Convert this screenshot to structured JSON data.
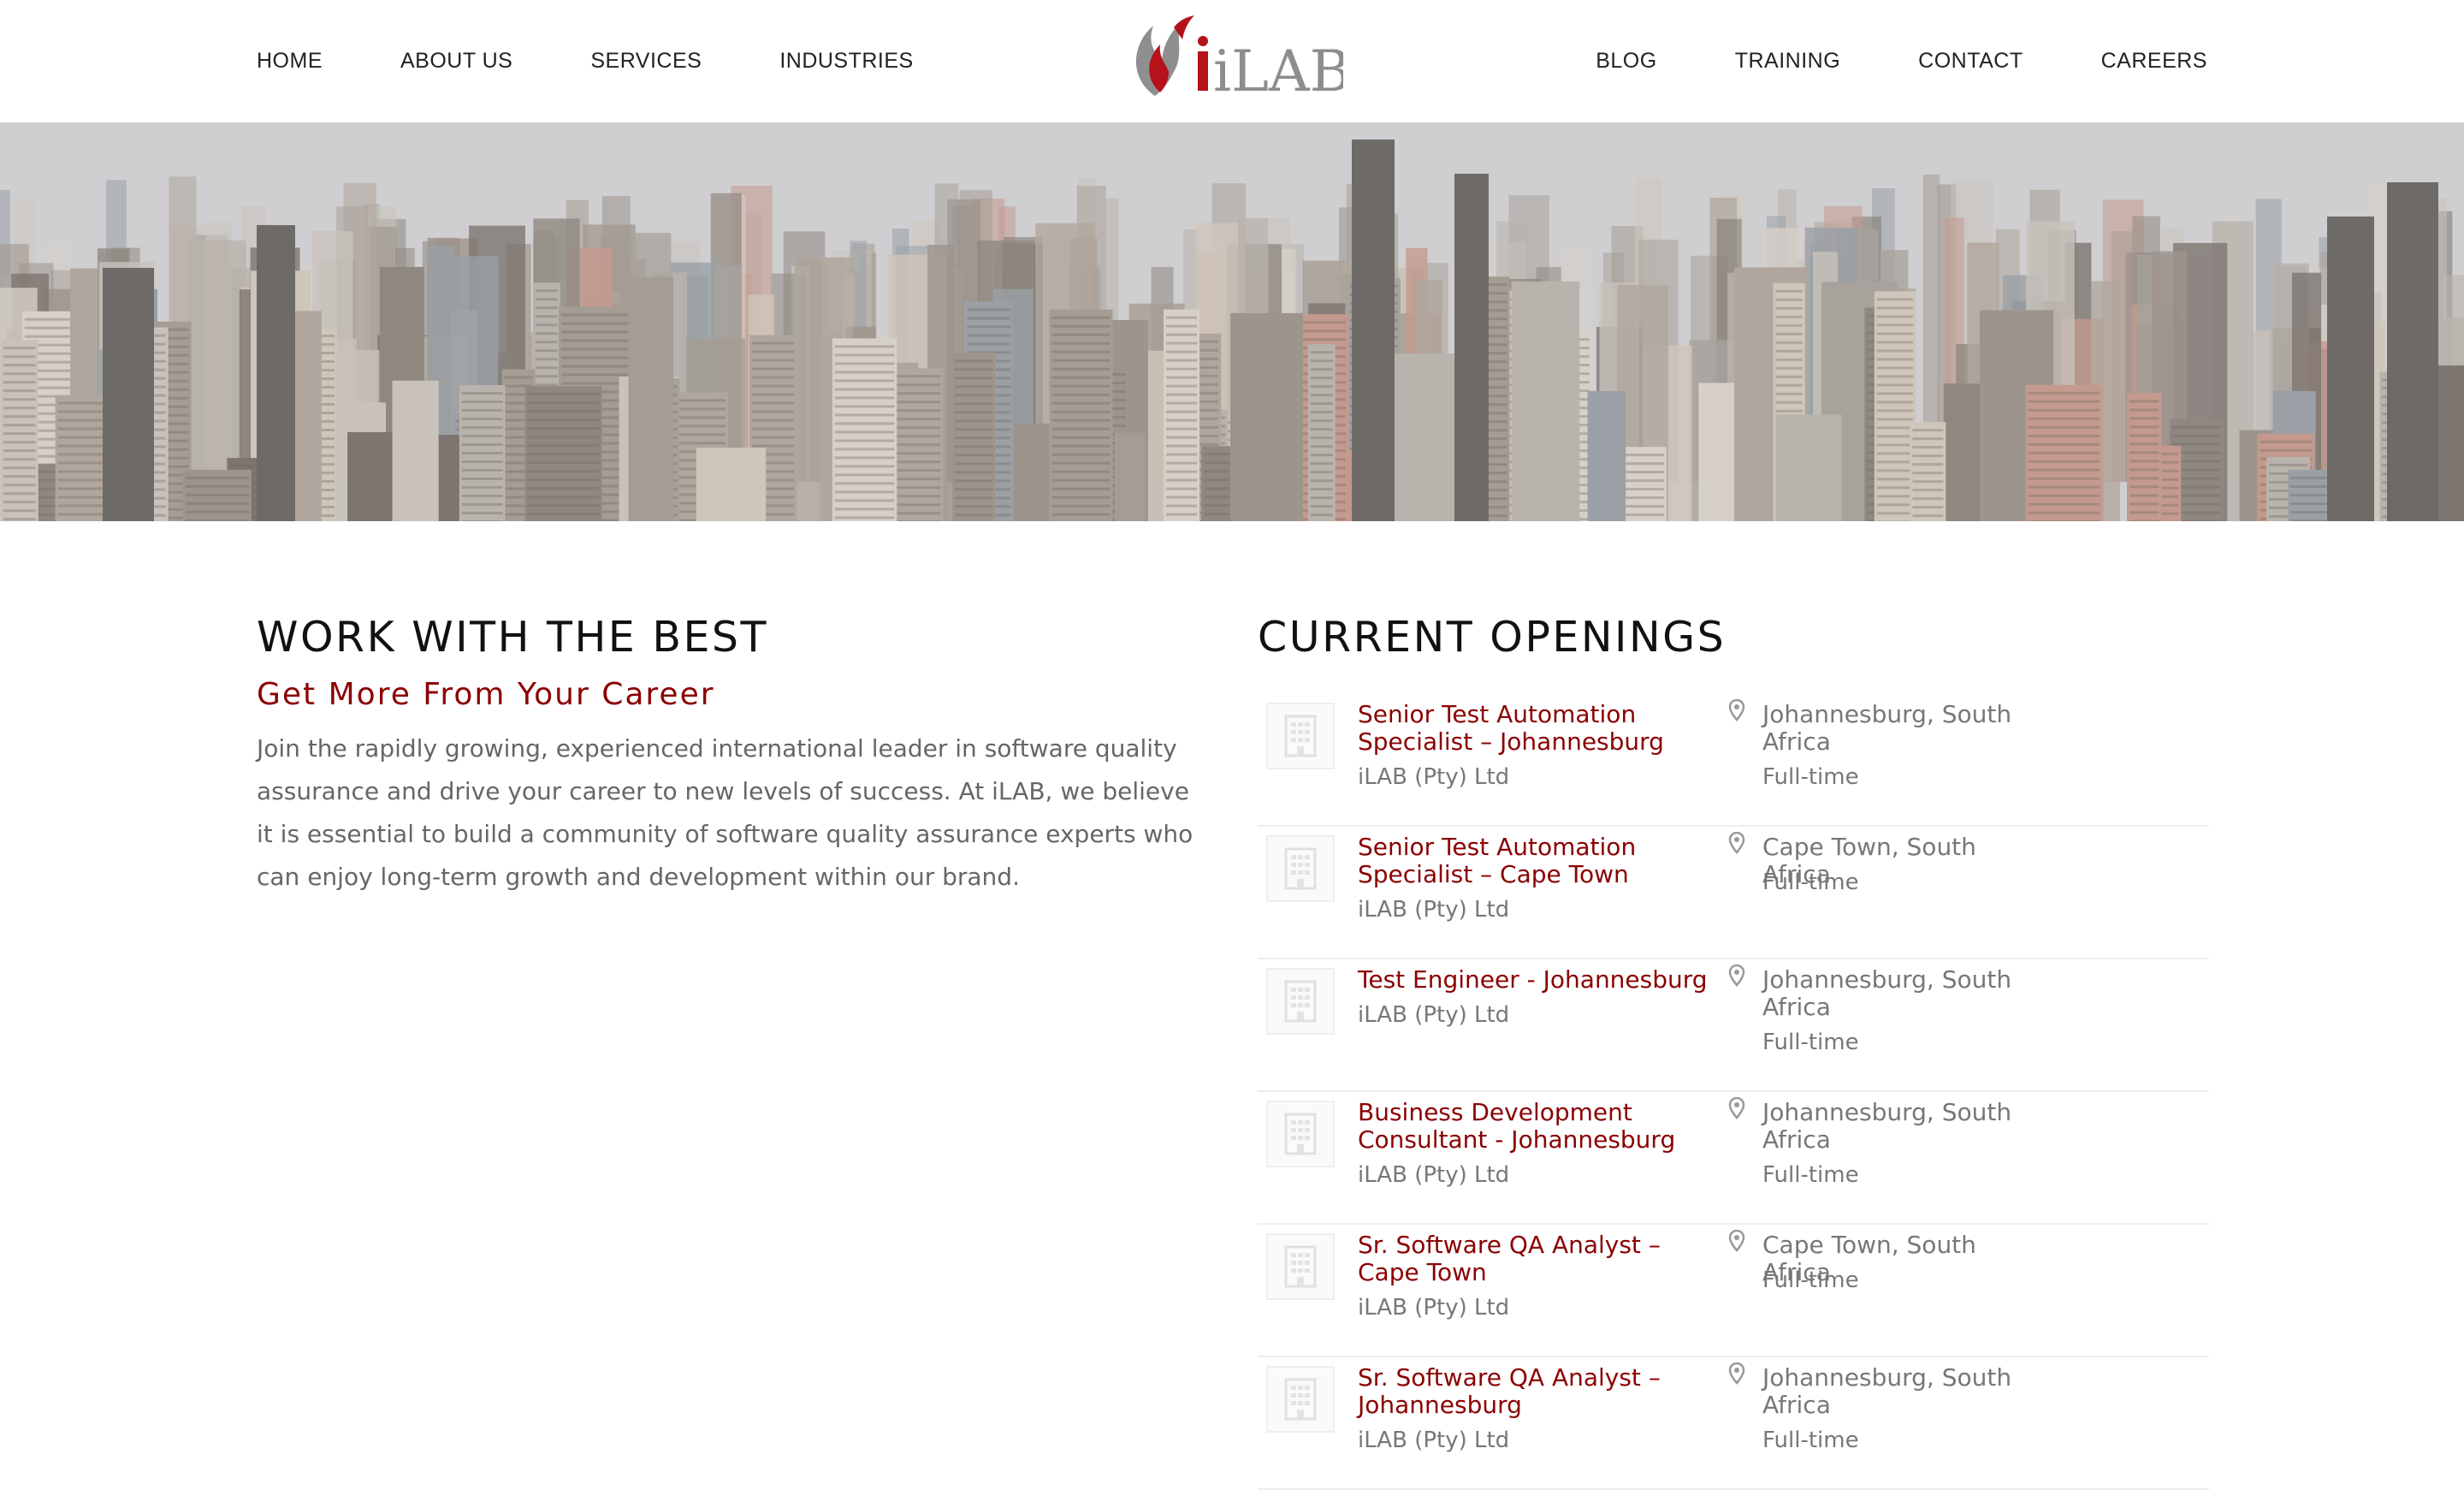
{
  "nav": {
    "left": [
      "HOME",
      "ABOUT US",
      "SERVICES",
      "INDUSTRIES"
    ],
    "right": [
      "BLOG",
      "TRAINING",
      "CONTACT",
      "CAREERS"
    ]
  },
  "logo": {
    "text": "iLAB"
  },
  "intro": {
    "title": "WORK WITH THE BEST",
    "subtitle": "Get More From Your Career",
    "body": "Join the rapidly growing, experienced international leader in software quality assurance and drive your career to new levels of success.  At iLAB, we believe it is essential to build a community of software quality assurance experts who can enjoy long-term growth and development within our brand."
  },
  "openings": {
    "title": "CURRENT OPENINGS",
    "jobs": [
      {
        "title": "Senior Test Automation Specialist – Johannesburg",
        "company": "iLAB (Pty) Ltd",
        "location": "Johannesburg, South Africa",
        "type": "Full-time",
        "title_lines": 2,
        "location_lines": 2
      },
      {
        "title": "Senior Test Automation Specialist – Cape Town",
        "company": "iLAB (Pty) Ltd",
        "location": "Cape Town, South Africa",
        "type": "Full-time",
        "title_lines": 2,
        "location_lines": 1
      },
      {
        "title": "Test Engineer - Johannesburg",
        "company": "iLAB (Pty) Ltd",
        "location": "Johannesburg, South Africa",
        "type": "Full-time",
        "title_lines": 1,
        "location_lines": 2
      },
      {
        "title": "Business Development Consultant - Johannesburg",
        "company": "iLAB (Pty) Ltd",
        "location": "Johannesburg, South Africa",
        "type": "Full-time",
        "title_lines": 2,
        "location_lines": 2
      },
      {
        "title": "Sr. Software QA Analyst – Cape Town",
        "company": "iLAB (Pty) Ltd",
        "location": "Cape Town, South Africa",
        "type": "Full-time",
        "title_lines": 2,
        "location_lines": 1
      },
      {
        "title": "Sr. Software QA Analyst – Johannesburg",
        "company": "iLAB (Pty) Ltd",
        "location": "Johannesburg, South Africa",
        "type": "Full-time",
        "title_lines": 2,
        "location_lines": 2
      }
    ]
  },
  "colors": {
    "accent": "#8b0000",
    "text": "#111111",
    "muted": "#777777"
  }
}
